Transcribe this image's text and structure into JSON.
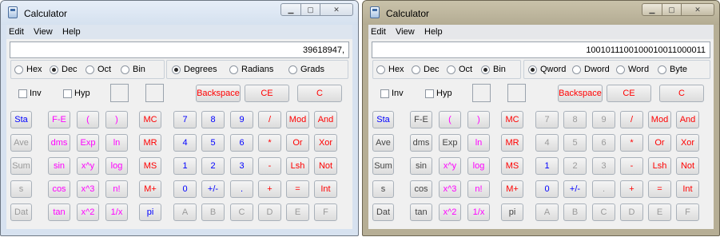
{
  "title": "Calculator",
  "windows": [
    {
      "window_title": "Calculator",
      "menu": [
        "Edit",
        "View",
        "Help"
      ],
      "display": "39618947,",
      "base_group": [
        "Hex",
        "Dec",
        "Oct",
        "Bin"
      ],
      "base_selected": "Dec",
      "mode_group": [
        "Degrees",
        "Radians",
        "Grads"
      ],
      "mode_selected": "Degrees",
      "checks": [
        "Inv",
        "Hyp"
      ],
      "edit_buttons": [
        "Backspace",
        "CE",
        "C"
      ],
      "left_buttons": [
        [
          "Sta",
          "F-E",
          "(",
          ")"
        ],
        [
          "Ave",
          "dms",
          "Exp",
          "ln"
        ],
        [
          "Sum",
          "sin",
          "x^y",
          "log"
        ],
        [
          "s",
          "cos",
          "x^3",
          "n!"
        ],
        [
          "Dat",
          "tan",
          "x^2",
          "1/x"
        ]
      ],
      "left_colors": [
        [
          "blue",
          "pink",
          "pink",
          "pink"
        ],
        [
          "disabled",
          "pink",
          "pink",
          "pink"
        ],
        [
          "disabled",
          "pink",
          "pink",
          "pink"
        ],
        [
          "disabled",
          "pink",
          "pink",
          "pink"
        ],
        [
          "disabled",
          "pink",
          "pink",
          "pink"
        ]
      ],
      "pi_label": "",
      "mem_buttons": [
        "MC",
        "MR",
        "MS",
        "M+"
      ],
      "num_buttons": [
        [
          "7",
          "8",
          "9",
          "/",
          "Mod",
          "And"
        ],
        [
          "4",
          "5",
          "6",
          "*",
          "Or",
          "Xor"
        ],
        [
          "1",
          "2",
          "3",
          "-",
          "Lsh",
          "Not"
        ],
        [
          "0",
          "+/-",
          ".",
          "+",
          "=",
          "Int"
        ],
        [
          "A",
          "B",
          "C",
          "D",
          "E",
          "F"
        ]
      ],
      "num_colors": [
        [
          "blue",
          "blue",
          "blue",
          "red",
          "red",
          "red"
        ],
        [
          "blue",
          "blue",
          "blue",
          "red",
          "red",
          "red"
        ],
        [
          "blue",
          "blue",
          "blue",
          "red",
          "red",
          "red"
        ],
        [
          "blue",
          "blue",
          "blue",
          "red",
          "red",
          "red"
        ],
        [
          "disabled",
          "disabled",
          "disabled",
          "disabled",
          "disabled",
          "disabled"
        ]
      ],
      "extra_button": "pi",
      "extra_color": "blue"
    },
    {
      "window_title": "Calculator",
      "menu": [
        "Edit",
        "View",
        "Help"
      ],
      "display": "1001011100100010011000011",
      "base_group": [
        "Hex",
        "Dec",
        "Oct",
        "Bin"
      ],
      "base_selected": "Bin",
      "mode_group": [
        "Qword",
        "Dword",
        "Word",
        "Byte"
      ],
      "mode_selected": "Qword",
      "checks": [
        "Inv",
        "Hyp"
      ],
      "edit_buttons": [
        "Backspace",
        "CE",
        "C"
      ],
      "left_buttons": [
        [
          "Sta",
          "F-E",
          "(",
          ")"
        ],
        [
          "Ave",
          "dms",
          "Exp",
          "ln"
        ],
        [
          "Sum",
          "sin",
          "x^y",
          "log"
        ],
        [
          "s",
          "cos",
          "x^3",
          "n!"
        ],
        [
          "Dat",
          "tan",
          "x^2",
          "1/x"
        ]
      ],
      "left_colors": [
        [
          "blue",
          "gray",
          "pink",
          "pink"
        ],
        [
          "gray",
          "gray",
          "gray",
          "pink"
        ],
        [
          "gray",
          "gray",
          "pink",
          "pink"
        ],
        [
          "gray",
          "gray",
          "pink",
          "pink"
        ],
        [
          "gray",
          "gray",
          "pink",
          "pink"
        ]
      ],
      "mem_buttons": [
        "MC",
        "MR",
        "MS",
        "M+"
      ],
      "num_buttons": [
        [
          "7",
          "8",
          "9",
          "/",
          "Mod",
          "And"
        ],
        [
          "4",
          "5",
          "6",
          "*",
          "Or",
          "Xor"
        ],
        [
          "1",
          "2",
          "3",
          "-",
          "Lsh",
          "Not"
        ],
        [
          "0",
          "+/-",
          ".",
          "+",
          "=",
          "Int"
        ],
        [
          "A",
          "B",
          "C",
          "D",
          "E",
          "F"
        ]
      ],
      "num_colors": [
        [
          "disabled",
          "disabled",
          "disabled",
          "red",
          "red",
          "red"
        ],
        [
          "disabled",
          "disabled",
          "disabled",
          "red",
          "red",
          "red"
        ],
        [
          "blue",
          "disabled",
          "disabled",
          "red",
          "red",
          "red"
        ],
        [
          "blue",
          "blue",
          "disabled",
          "red",
          "red",
          "red"
        ],
        [
          "disabled",
          "disabled",
          "disabled",
          "disabled",
          "disabled",
          "disabled"
        ]
      ],
      "extra_button": "pi",
      "extra_color": "gray"
    }
  ],
  "colors": {
    "blue": "#0000ff",
    "red": "#ff0000",
    "pink": "#ff00ff",
    "gray": "#444444",
    "disabled": "#9a9a9a"
  },
  "icons": {
    "app": "calculator-icon",
    "minimize": "minimize-icon",
    "maximize": "maximize-icon",
    "close": "close-icon"
  }
}
